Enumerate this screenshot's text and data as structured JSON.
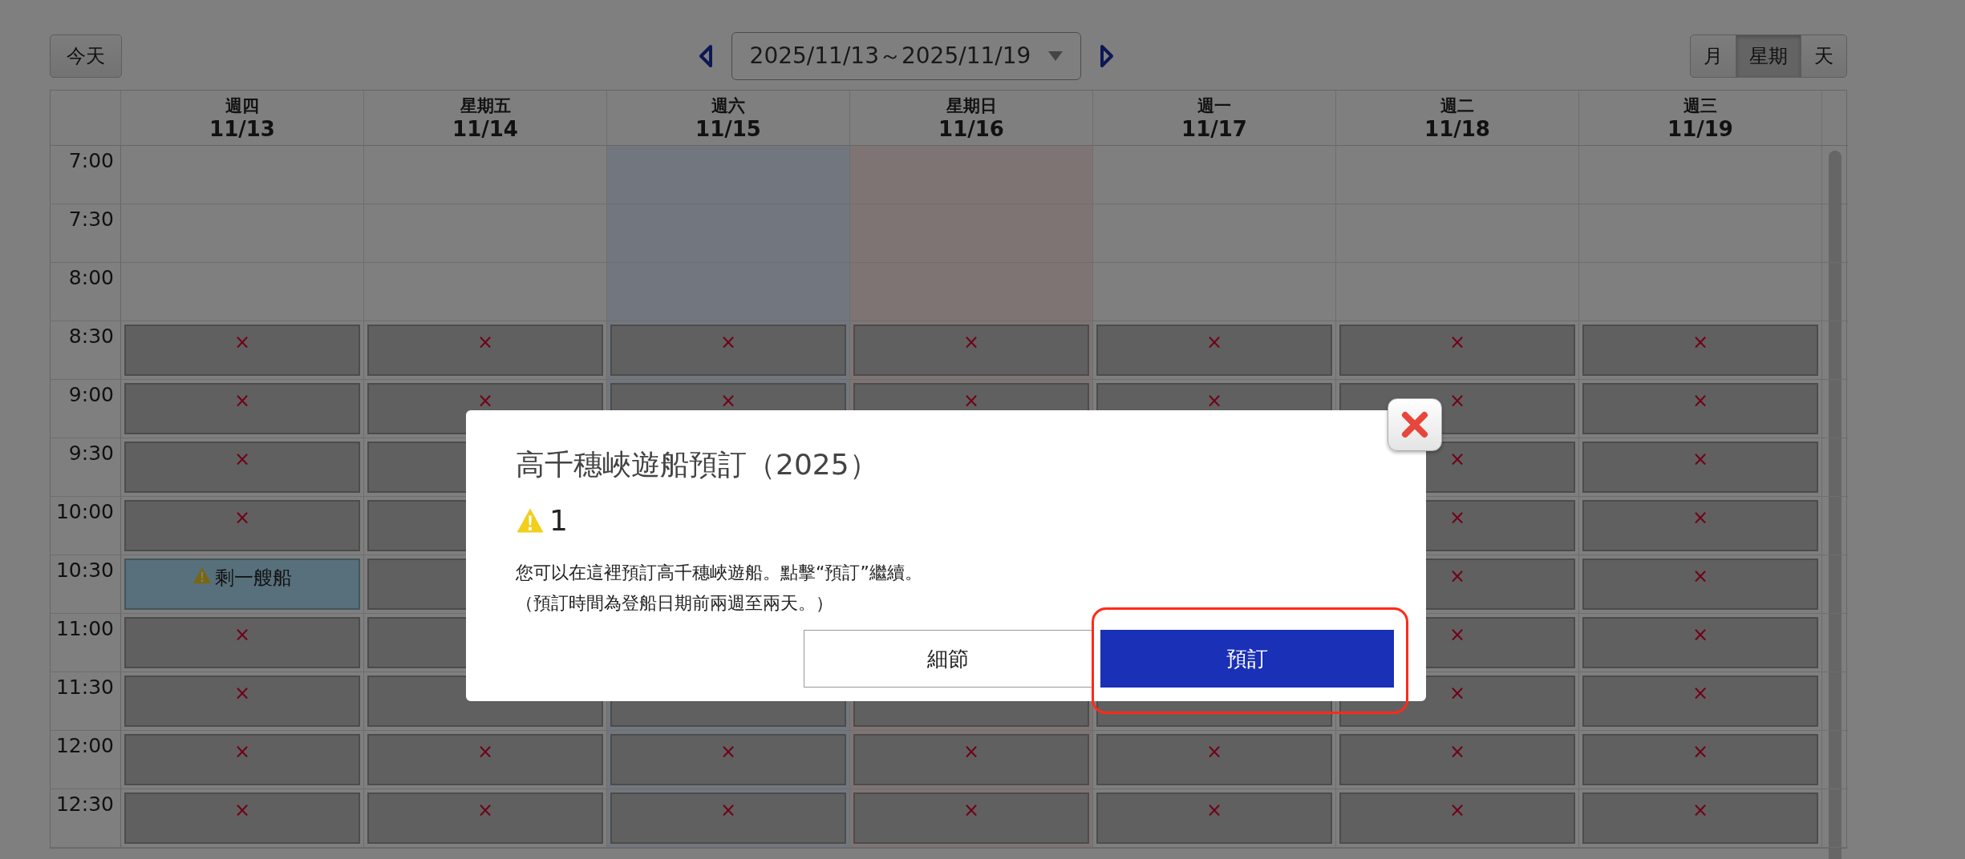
{
  "toolbar": {
    "today_button": "今天",
    "date_range": "2025/11/13～2025/11/19",
    "views": [
      {
        "label": "月",
        "selected": false
      },
      {
        "label": "星期",
        "selected": true
      },
      {
        "label": "天",
        "selected": false
      }
    ]
  },
  "days": [
    {
      "weekday": "週四",
      "date": "11/13",
      "kind": "weekday"
    },
    {
      "weekday": "星期五",
      "date": "11/14",
      "kind": "weekday"
    },
    {
      "weekday": "週六",
      "date": "11/15",
      "kind": "saturday"
    },
    {
      "weekday": "星期日",
      "date": "11/16",
      "kind": "sunday"
    },
    {
      "weekday": "週一",
      "date": "11/17",
      "kind": "weekday"
    },
    {
      "weekday": "週二",
      "date": "11/18",
      "kind": "weekday"
    },
    {
      "weekday": "週三",
      "date": "11/19",
      "kind": "weekday"
    }
  ],
  "rows": [
    {
      "time": "7:00",
      "slots": [
        {
          "kind": "empty"
        },
        {
          "kind": "empty"
        },
        {
          "kind": "empty"
        },
        {
          "kind": "empty"
        },
        {
          "kind": "empty"
        },
        {
          "kind": "empty"
        },
        {
          "kind": "empty"
        }
      ]
    },
    {
      "time": "7:30",
      "slots": [
        {
          "kind": "empty"
        },
        {
          "kind": "empty"
        },
        {
          "kind": "empty"
        },
        {
          "kind": "empty"
        },
        {
          "kind": "empty"
        },
        {
          "kind": "empty"
        },
        {
          "kind": "empty"
        }
      ]
    },
    {
      "time": "8:00",
      "slots": [
        {
          "kind": "empty"
        },
        {
          "kind": "empty"
        },
        {
          "kind": "empty"
        },
        {
          "kind": "empty"
        },
        {
          "kind": "empty"
        },
        {
          "kind": "empty"
        },
        {
          "kind": "empty"
        }
      ]
    },
    {
      "time": "8:30",
      "slots": [
        {
          "kind": "closed",
          "mark": "×"
        },
        {
          "kind": "closed",
          "mark": "×"
        },
        {
          "kind": "closed",
          "mark": "×"
        },
        {
          "kind": "closed",
          "mark": "×"
        },
        {
          "kind": "closed",
          "mark": "×"
        },
        {
          "kind": "closed",
          "mark": "×"
        },
        {
          "kind": "closed",
          "mark": "×"
        }
      ]
    },
    {
      "time": "9:00",
      "slots": [
        {
          "kind": "closed",
          "mark": "×"
        },
        {
          "kind": "closed",
          "mark": "×"
        },
        {
          "kind": "closed",
          "mark": "×"
        },
        {
          "kind": "closed",
          "mark": "×"
        },
        {
          "kind": "closed",
          "mark": "×"
        },
        {
          "kind": "closed",
          "mark": "×"
        },
        {
          "kind": "closed",
          "mark": "×"
        }
      ]
    },
    {
      "time": "9:30",
      "slots": [
        {
          "kind": "closed",
          "mark": "×"
        },
        {
          "kind": "covered"
        },
        {
          "kind": "hidden"
        },
        {
          "kind": "hidden"
        },
        {
          "kind": "hidden"
        },
        {
          "kind": "closed",
          "mark": "×"
        },
        {
          "kind": "closed",
          "mark": "×"
        }
      ]
    },
    {
      "time": "10:00",
      "slots": [
        {
          "kind": "closed",
          "mark": "×"
        },
        {
          "kind": "covered"
        },
        {
          "kind": "hidden"
        },
        {
          "kind": "hidden"
        },
        {
          "kind": "hidden"
        },
        {
          "kind": "closed",
          "mark": "×"
        },
        {
          "kind": "closed",
          "mark": "×"
        }
      ]
    },
    {
      "time": "10:30",
      "slots": [
        {
          "kind": "few",
          "text": "剩一艘船"
        },
        {
          "kind": "covered"
        },
        {
          "kind": "hidden"
        },
        {
          "kind": "hidden"
        },
        {
          "kind": "hidden"
        },
        {
          "kind": "closed",
          "mark": "×"
        },
        {
          "kind": "closed",
          "mark": "×"
        }
      ]
    },
    {
      "time": "11:00",
      "slots": [
        {
          "kind": "closed",
          "mark": "×"
        },
        {
          "kind": "covered"
        },
        {
          "kind": "hidden"
        },
        {
          "kind": "hidden"
        },
        {
          "kind": "hidden"
        },
        {
          "kind": "closed",
          "mark": "×"
        },
        {
          "kind": "closed",
          "mark": "×"
        }
      ]
    },
    {
      "time": "11:30",
      "slots": [
        {
          "kind": "closed",
          "mark": "×"
        },
        {
          "kind": "covered"
        },
        {
          "kind": "covered"
        },
        {
          "kind": "covered"
        },
        {
          "kind": "covered"
        },
        {
          "kind": "closed",
          "mark": "×"
        },
        {
          "kind": "closed",
          "mark": "×"
        }
      ]
    },
    {
      "time": "12:00",
      "slots": [
        {
          "kind": "closed",
          "mark": "×"
        },
        {
          "kind": "closed",
          "mark": "×"
        },
        {
          "kind": "closed",
          "mark": "×"
        },
        {
          "kind": "closed",
          "mark": "×"
        },
        {
          "kind": "closed",
          "mark": "×"
        },
        {
          "kind": "closed",
          "mark": "×"
        },
        {
          "kind": "closed",
          "mark": "×"
        }
      ]
    },
    {
      "time": "12:30",
      "slots": [
        {
          "kind": "closed",
          "mark": "×"
        },
        {
          "kind": "closed",
          "mark": "×"
        },
        {
          "kind": "closed",
          "mark": "×"
        },
        {
          "kind": "closed",
          "mark": "×"
        },
        {
          "kind": "closed",
          "mark": "×"
        },
        {
          "kind": "closed",
          "mark": "×"
        },
        {
          "kind": "closed",
          "mark": "×"
        }
      ]
    }
  ],
  "dialog": {
    "title": "高千穗峽遊船預訂（2025）",
    "count": "1",
    "message": "您可以在這裡預訂高千穗峽遊船。點擊“預訂”繼續。",
    "note": "（預訂時間為登船日期前兩週至兩天。）",
    "buttons": [
      {
        "label": "細節",
        "kind": "secondary",
        "highlighted": false
      },
      {
        "label": "預訂",
        "kind": "primary",
        "highlighted": true
      }
    ]
  }
}
